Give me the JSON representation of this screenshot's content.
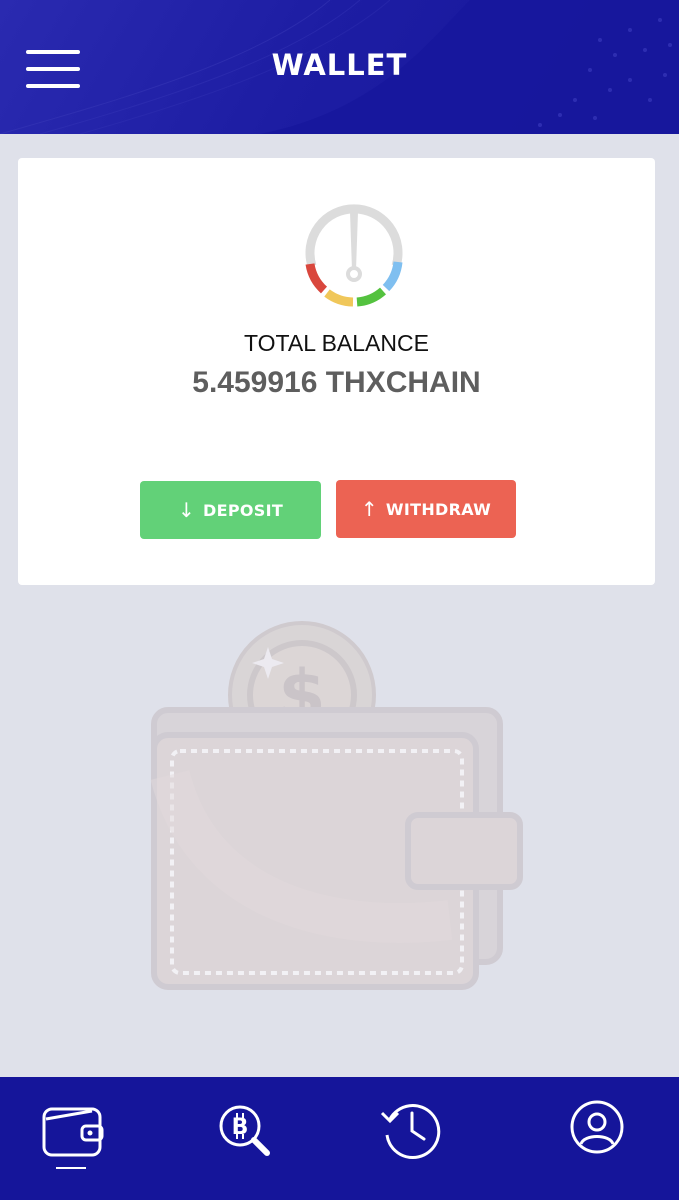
{
  "header": {
    "title": "WALLET",
    "menu_icon": "hamburger-menu-icon",
    "background": "#1d1da3"
  },
  "balance_card": {
    "gauge_icon": "gauge-icon",
    "label": "TOTAL BALANCE",
    "amount": "5.459916 THXCHAIN",
    "deposit": {
      "arrow": "↓",
      "label": "DEPOSIT",
      "color": "#62d178"
    },
    "withdraw": {
      "arrow": "↑",
      "label": "WITHDRAW",
      "color": "#ec6353"
    }
  },
  "illustration": {
    "icon": "wallet-coin-illustration"
  },
  "bottom_nav": {
    "items": [
      {
        "icon": "wallet-icon",
        "active": true
      },
      {
        "icon": "bitcoin-search-icon",
        "active": false
      },
      {
        "icon": "history-icon",
        "active": false
      },
      {
        "icon": "user-profile-icon",
        "active": false
      }
    ],
    "background": "#15159a"
  }
}
